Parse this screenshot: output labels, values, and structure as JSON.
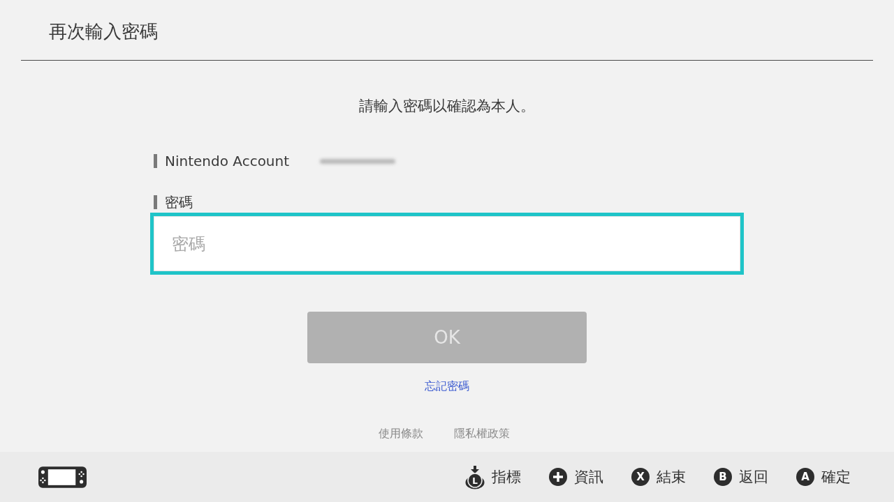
{
  "header": {
    "title": "再次輸入密碼"
  },
  "prompt": "請輸入密碼以確認為本人。",
  "account": {
    "label": "Nintendo Account",
    "blurred": true
  },
  "password": {
    "label": "密碼",
    "placeholder": "密碼",
    "focused": true
  },
  "ok_button": {
    "label": "OK",
    "disabled": true
  },
  "forgot_link": "忘記密碼",
  "footer_links": [
    "使用條款",
    "隱私權政策"
  ],
  "bottom_bar": {
    "hints": [
      {
        "kind": "stick",
        "key": "L",
        "label": "指標"
      },
      {
        "kind": "plus",
        "label": "資訊"
      },
      {
        "kind": "button",
        "key": "X",
        "label": "結束"
      },
      {
        "kind": "button",
        "key": "B",
        "label": "返回"
      },
      {
        "kind": "button",
        "key": "A",
        "label": "確定"
      }
    ]
  }
}
